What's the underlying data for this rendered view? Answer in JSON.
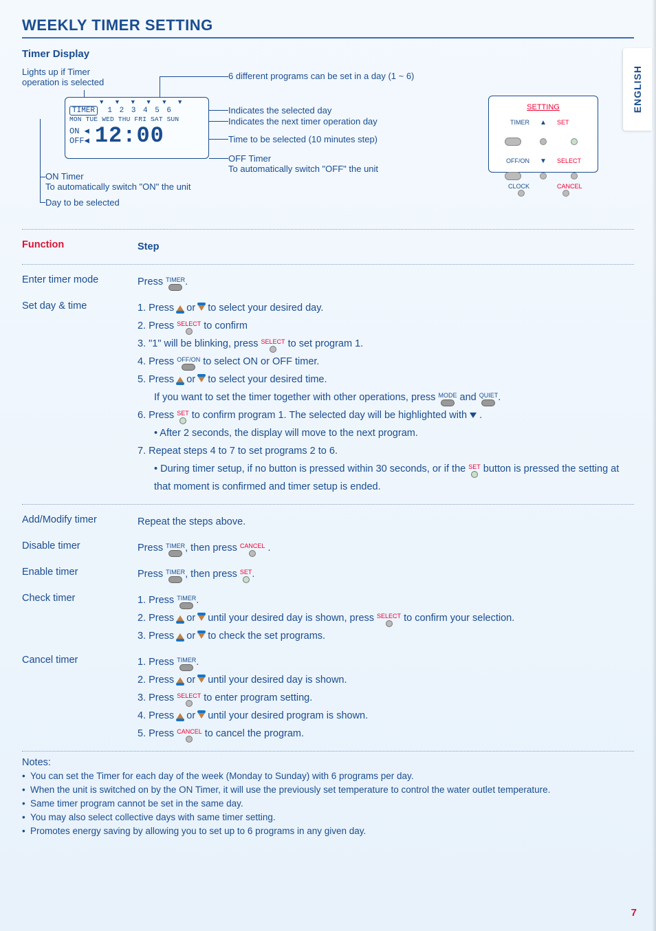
{
  "header": {
    "title": "WEEKLY TIMER SETTING",
    "subtitle": "Timer Display",
    "side_tab": "ENGLISH"
  },
  "display": {
    "callout_lights": "Lights up if Timer operation is selected",
    "callout_programs": "6 different programs can be set in a day (1 ~ 6)",
    "callout_selected_day": "Indicates the selected day",
    "callout_next_day": "Indicates the next timer operation day",
    "callout_time": "Time to be selected (10 minutes step)",
    "callout_off_timer_title": "OFF Timer",
    "callout_off_timer_text": "To automatically switch \"OFF\" the unit",
    "callout_on_timer_title": "ON Timer",
    "callout_on_timer_text": "To automatically switch \"ON\" the unit",
    "callout_day_select": "Day to be selected",
    "lcd": {
      "timer_box": "TIMER",
      "program_numbers": "1 2 3 4 5 6",
      "days": "MON TUE WED THU FRI SAT SUN",
      "on": "ON ◀",
      "off": "OFF◀",
      "time": "12:00"
    },
    "remote": {
      "title": "SETTING",
      "timer": "TIMER",
      "off_on": "OFF/ON",
      "clock": "CLOCK",
      "set": "SET",
      "select": "SELECT",
      "cancel": "CANCEL"
    }
  },
  "table": {
    "header_function": "Function",
    "header_step": "Step",
    "rows": {
      "enter": {
        "label": "Enter timer mode",
        "press": "Press",
        "timer": "TIMER"
      },
      "setday": {
        "label": "Set day & time",
        "s1a": "1. Press",
        "s1b": "or",
        "s1c": "to select your desired day.",
        "s2a": "2. Press",
        "s2b": "to confirm",
        "select": "SELECT",
        "s3a": "3. \"1\" will be blinking, press",
        "s3b": "to set program 1.",
        "s4a": "4. Press",
        "s4b": "to select ON or OFF timer.",
        "offon": "OFF/ON",
        "s5a": "5. Press",
        "s5b": "or",
        "s5c": "to select your desired time.",
        "s5d": "If you want to set the timer together with other operations, press",
        "s5e": "and",
        "mode": "MODE",
        "quiet": "QUIET",
        "s6a": "6. Press",
        "s6b": "to confirm program 1. The selected day will be highlighted with",
        "set": "SET",
        "s6c": "• After 2 seconds, the display will move to the next program.",
        "s7a": "7. Repeat steps 4 to 7 to set programs 2 to 6.",
        "s7b": "• During timer setup, if no button is pressed within 30 seconds, or if the",
        "s7c": "button is pressed the setting at that moment is confirmed and timer setup is ended."
      },
      "addmod": {
        "label": "Add/Modify timer",
        "text": "Repeat the steps above."
      },
      "disable": {
        "label": "Disable timer",
        "press": "Press",
        "then": ", then press",
        "timer": "TIMER",
        "cancel": "CANCEL"
      },
      "enable": {
        "label": "Enable timer",
        "press": "Press",
        "then": ", then press",
        "timer": "TIMER",
        "set": "SET"
      },
      "check": {
        "label": "Check timer",
        "s1": "1. Press",
        "timer": "TIMER",
        "s2a": "2. Press",
        "s2b": "or",
        "s2c": "until your desired day is shown, press",
        "s2d": "to confirm your selection.",
        "select": "SELECT",
        "s3a": "3. Press",
        "s3b": "or",
        "s3c": "to check the set programs."
      },
      "cancel": {
        "label": "Cancel timer",
        "s1": "1. Press",
        "timer": "TIMER",
        "s2a": "2. Press",
        "s2b": "or",
        "s2c": "until your desired day is shown.",
        "s3a": "3. Press",
        "s3b": "to enter program setting.",
        "select": "SELECT",
        "s4a": "4. Press",
        "s4b": "or",
        "s4c": "until your desired program is shown.",
        "s5a": "5. Press",
        "s5b": "to cancel the program.",
        "cancel_lbl": "CANCEL"
      }
    }
  },
  "notes": {
    "title": "Notes:",
    "items": [
      "You can set the Timer for each day of the week (Monday to Sunday) with 6 programs per day.",
      "When the unit is switched on by the ON Timer, it will use the previously set temperature to control the water outlet temperature.",
      "Same timer program cannot be set in the same day.",
      "You may also select collective days with same timer setting.",
      "Promotes energy saving by allowing you to set up to 6 programs in any given day."
    ]
  },
  "page_number": "7"
}
